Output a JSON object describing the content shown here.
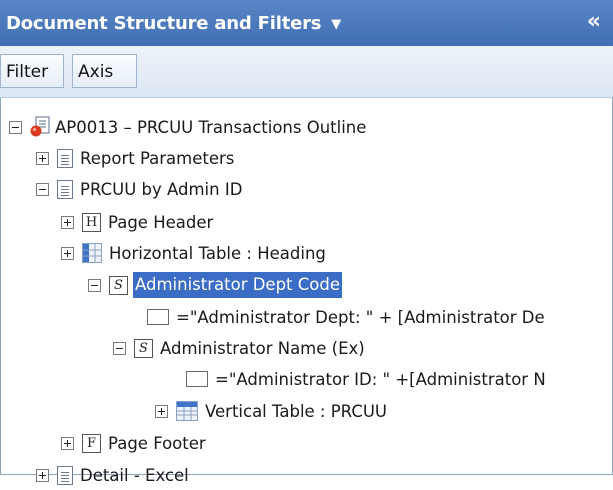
{
  "panel": {
    "title": "Document Structure and Filters",
    "title_dropdown_icon": "caret-down-icon",
    "collapse_icon": "double-chevron-left-icon",
    "collapse_glyph": "«",
    "dropdown_glyph": "▼"
  },
  "toolbar": {
    "tabs": [
      {
        "label": "Filter"
      },
      {
        "label": "Axis"
      }
    ]
  },
  "tree": {
    "selected_color": "#3b6cc6",
    "items": [
      {
        "label": "AP0013 – PRCUU Transactions Outline",
        "icon": "report-document-icon",
        "state": "expanded"
      },
      {
        "label": "Report Parameters",
        "icon": "report-page-icon",
        "state": "collapsed"
      },
      {
        "label": "PRCUU by Admin ID",
        "icon": "report-page-icon",
        "state": "expanded"
      },
      {
        "label": "Page Header",
        "icon": "header-section-icon",
        "icon_text": "H",
        "state": "collapsed"
      },
      {
        "label": "Horizontal Table : Heading",
        "icon": "horizontal-table-icon",
        "state": "collapsed"
      },
      {
        "label": "Administrator Dept Code",
        "icon": "section-icon",
        "icon_text": "S",
        "state": "expanded",
        "selected": true
      },
      {
        "label": "=\"Administrator Dept: \" + [Administrator De",
        "icon": "cell-icon"
      },
      {
        "label": "Administrator Name (Ex)",
        "icon": "section-icon",
        "icon_text": "S",
        "state": "expanded"
      },
      {
        "label": "=\"Administrator ID: \" +[Administrator N",
        "icon": "cell-icon"
      },
      {
        "label": "Vertical Table : PRCUU",
        "icon": "vertical-table-icon",
        "state": "collapsed"
      },
      {
        "label": "Page Footer",
        "icon": "footer-section-icon",
        "icon_text": "F",
        "state": "collapsed"
      },
      {
        "label": "Detail - Excel",
        "icon": "report-page-icon",
        "state": "collapsed"
      }
    ]
  }
}
